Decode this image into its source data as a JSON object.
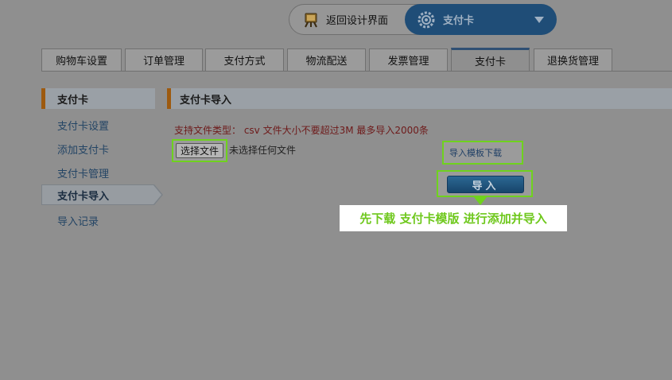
{
  "top_switcher": {
    "back_label": "返回设计界面",
    "back_icon": "design-easel-icon",
    "current_label": "支付卡",
    "current_icon": "gear-icon"
  },
  "tabs": [
    {
      "label": "购物车设置",
      "active": false
    },
    {
      "label": "订单管理",
      "active": false
    },
    {
      "label": "支付方式",
      "active": false
    },
    {
      "label": "物流配送",
      "active": false
    },
    {
      "label": "发票管理",
      "active": false
    },
    {
      "label": "支付卡",
      "active": true
    },
    {
      "label": "退换货管理",
      "active": false
    }
  ],
  "sidebar": {
    "header": "支付卡",
    "items": [
      {
        "label": "支付卡设置"
      },
      {
        "label": "添加支付卡"
      },
      {
        "label": "支付卡管理"
      },
      {
        "label": "支付卡导入"
      },
      {
        "label": "导入记录"
      }
    ],
    "active_item": "支付卡导入"
  },
  "content": {
    "title": "支付卡导入",
    "hint": "支持文件类型： csv   文件大小不要超过3M   最多导入2000条",
    "file_button": "选择文件",
    "file_status": "未选择任何文件",
    "template_link": "导入模板下载",
    "import_button": "导入",
    "tip": "先下载 支付卡模版 进行添加并导入"
  },
  "colors": {
    "overlay_bg": "#8f8f8f",
    "highlight_green": "#6fd21e",
    "accent_brown": "#9d5a10",
    "button_blue": "#17456b",
    "hint_red": "#6e1a1a"
  }
}
